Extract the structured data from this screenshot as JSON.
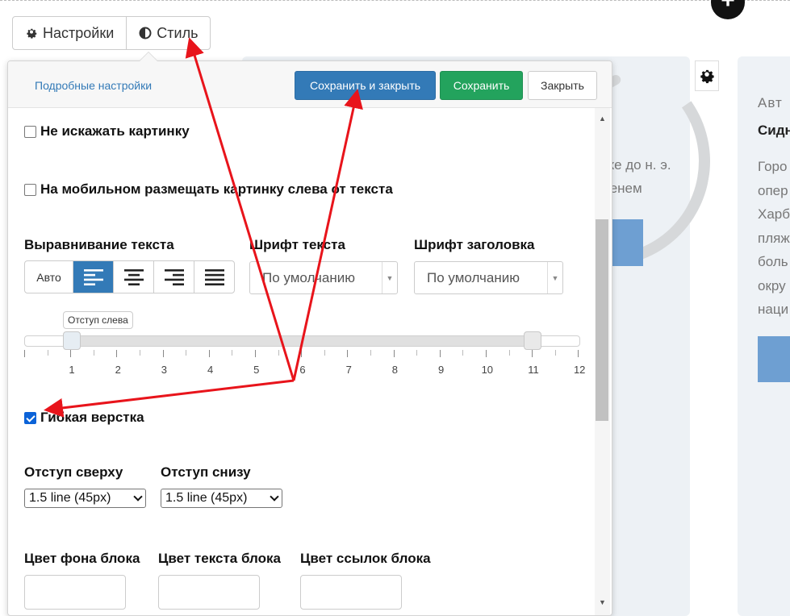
{
  "tabs": [
    {
      "label": "Настройки",
      "icon": "gear-icon"
    },
    {
      "label": "Стиль",
      "icon": "contrast-icon"
    }
  ],
  "panel": {
    "advanced_link": "Подробные настройки",
    "buttons": {
      "save_close": "Сохранить и закрыть",
      "save": "Сохранить",
      "close": "Закрыть"
    }
  },
  "options": {
    "no_distort": {
      "label": "Не искажать картинку",
      "checked": false
    },
    "mobile_left": {
      "label": "На мобильном размещать картинку слева от текста",
      "checked": false
    },
    "flexible": {
      "label": "Гибкая верстка",
      "checked": true
    }
  },
  "text_align": {
    "label": "Выравнивание текста",
    "auto_label": "Авто",
    "options": [
      "align-left-icon",
      "align-center-icon",
      "align-right-icon",
      "align-justify-icon"
    ],
    "selected": "align-left-icon"
  },
  "font_text": {
    "label": "Шрифт текста",
    "value": "По умолчанию"
  },
  "font_heading": {
    "label": "Шрифт заголовка",
    "value": "По умолчанию"
  },
  "slider": {
    "tooltip": "Отступ слева",
    "ticks": [
      "1",
      "2",
      "3",
      "4",
      "5",
      "6",
      "7",
      "8",
      "9",
      "10",
      "11",
      "12"
    ],
    "min_value": 1,
    "max_value": 11
  },
  "padding_top": {
    "label": "Отступ сверху",
    "value": "1.5 line (45px)"
  },
  "padding_bottom": {
    "label": "Отступ снизу",
    "value": "1.5 line (45px)"
  },
  "colors": {
    "bg": "Цвет фона блока",
    "text": "Цвет текста блока",
    "links": "Цвет ссылок блока"
  },
  "background_page": {
    "text_line1": "еке до н. э.",
    "text_line2": "менем",
    "side_title": "Авт",
    "side_name": "Сидн",
    "side_body": "Горо\nопер\nХарб\nпляж\nболь\nокру\nнаци"
  },
  "accent_colors": {
    "primary": "#337ab7",
    "success": "#23a35d",
    "annotation_arrow": "#e8141b"
  }
}
